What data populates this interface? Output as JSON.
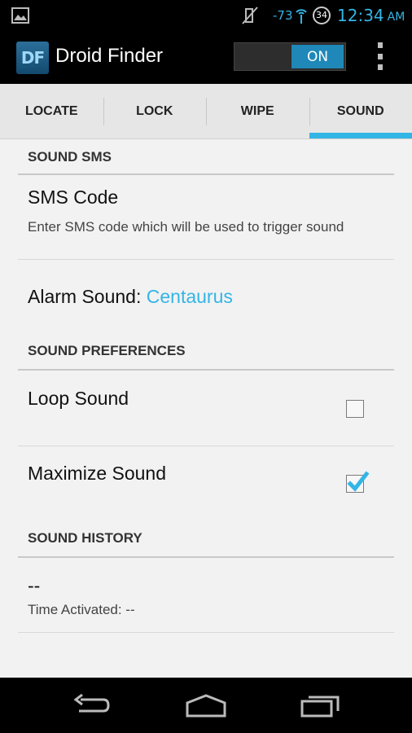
{
  "status_bar": {
    "signal": "-73",
    "sync_badge": "34",
    "time": "12:34",
    "ampm": "AM"
  },
  "app": {
    "logo_text": "DF",
    "title": "Droid Finder",
    "toggle_label": "ON"
  },
  "tabs": [
    {
      "label": "LOCATE"
    },
    {
      "label": "LOCK"
    },
    {
      "label": "WIPE"
    },
    {
      "label": "SOUND",
      "active": true
    }
  ],
  "sections": {
    "sound_sms": {
      "header": "SOUND SMS",
      "sms_code_title": "SMS Code",
      "sms_code_summary": "Enter SMS code which will be used to trigger sound",
      "alarm_label": "Alarm Sound:",
      "alarm_value": "Centaurus"
    },
    "sound_preferences": {
      "header": "SOUND PREFERENCES",
      "loop_title": "Loop Sound",
      "loop_checked": false,
      "maximize_title": "Maximize Sound",
      "maximize_checked": true
    },
    "sound_history": {
      "header": "SOUND HISTORY",
      "value": "--",
      "time_activated": "Time Activated: --"
    }
  },
  "colors": {
    "accent": "#33b5e5",
    "toggle_on": "#1f88b8"
  }
}
